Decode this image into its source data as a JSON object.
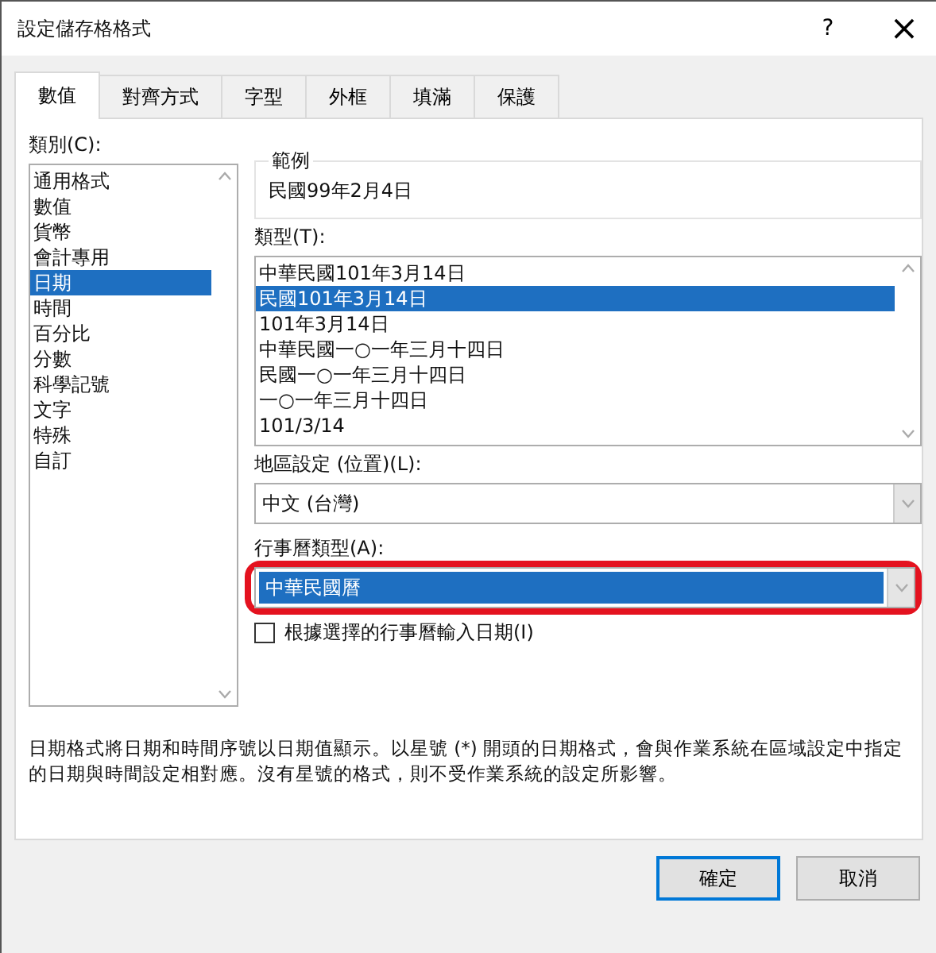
{
  "window": {
    "title": "設定儲存格格式",
    "help": "?",
    "close": "×"
  },
  "tabs": [
    {
      "label": "數值",
      "selected": true
    },
    {
      "label": "對齊方式",
      "selected": false
    },
    {
      "label": "字型",
      "selected": false
    },
    {
      "label": "外框",
      "selected": false
    },
    {
      "label": "填滿",
      "selected": false
    },
    {
      "label": "保護",
      "selected": false
    }
  ],
  "category": {
    "label": "類別(C):",
    "items": [
      {
        "label": "通用格式",
        "selected": false
      },
      {
        "label": "數值",
        "selected": false
      },
      {
        "label": "貨幣",
        "selected": false
      },
      {
        "label": "會計專用",
        "selected": false
      },
      {
        "label": "日期",
        "selected": true
      },
      {
        "label": "時間",
        "selected": false
      },
      {
        "label": "百分比",
        "selected": false
      },
      {
        "label": "分數",
        "selected": false
      },
      {
        "label": "科學記號",
        "selected": false
      },
      {
        "label": "文字",
        "selected": false
      },
      {
        "label": "特殊",
        "selected": false
      },
      {
        "label": "自訂",
        "selected": false
      }
    ]
  },
  "sample": {
    "label": "範例",
    "value": "民國99年2月4日"
  },
  "type": {
    "label": "類型(T):",
    "items": [
      {
        "label": "中華民國101年3月14日",
        "selected": false
      },
      {
        "label": "民國101年3月14日",
        "selected": true
      },
      {
        "label": "101年3月14日",
        "selected": false
      },
      {
        "label": "中華民國一○一年三月十四日",
        "selected": false
      },
      {
        "label": "民國一○一年三月十四日",
        "selected": false
      },
      {
        "label": "一○一年三月十四日",
        "selected": false
      },
      {
        "label": "101/3/14",
        "selected": false
      }
    ]
  },
  "locale": {
    "label": "地區設定 (位置)(L):",
    "value": "中文 (台灣)"
  },
  "calendar": {
    "label": "行事曆類型(A):",
    "value": "中華民國曆",
    "highlighted": true
  },
  "use_calendar": {
    "label": "根據選擇的行事曆輸入日期(I)",
    "checked": false
  },
  "description": "日期格式將日期和時間序號以日期值顯示。以星號 (*) 開頭的日期格式，會與作業系統在區域設定中指定的日期與時間設定相對應。沒有星號的格式，則不受作業系統的設定所影響。",
  "buttons": [
    {
      "label": "確定",
      "default": true
    },
    {
      "label": "取消",
      "default": false
    }
  ]
}
